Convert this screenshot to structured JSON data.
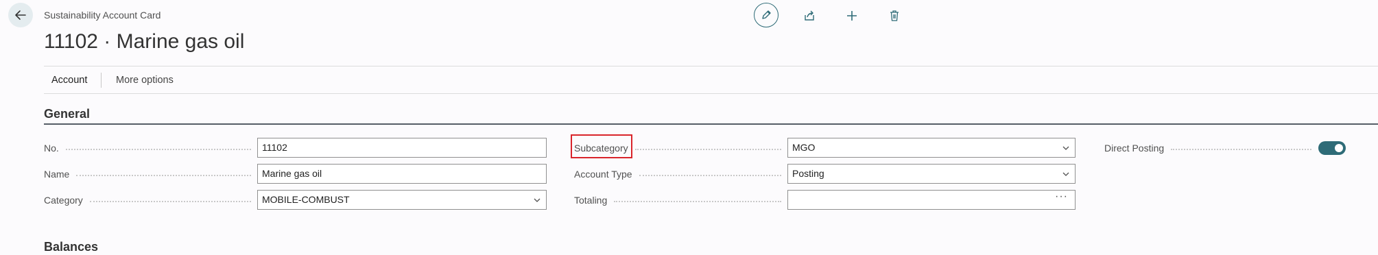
{
  "header": {
    "breadcrumb": "Sustainability Account Card",
    "title": "11102 · Marine gas oil"
  },
  "toolbar": {
    "edit_icon": "pencil-icon",
    "share_icon": "share-icon",
    "new_icon": "plus-icon",
    "delete_icon": "trash-icon"
  },
  "actions": {
    "account": "Account",
    "more_options": "More options"
  },
  "general": {
    "title": "General",
    "fields": {
      "no": {
        "label": "No.",
        "value": "11102"
      },
      "name": {
        "label": "Name",
        "value": "Marine gas oil"
      },
      "category": {
        "label": "Category",
        "value": "MOBILE-COMBUST"
      },
      "subcategory": {
        "label": "Subcategory",
        "value": "MGO"
      },
      "account_type": {
        "label": "Account Type",
        "value": "Posting"
      },
      "totaling": {
        "label": "Totaling",
        "value": ""
      },
      "direct_posting": {
        "label": "Direct Posting",
        "value": true
      }
    }
  },
  "balances": {
    "title": "Balances"
  },
  "colors": {
    "accent": "#2e6b77",
    "highlight": "#d9242a"
  }
}
